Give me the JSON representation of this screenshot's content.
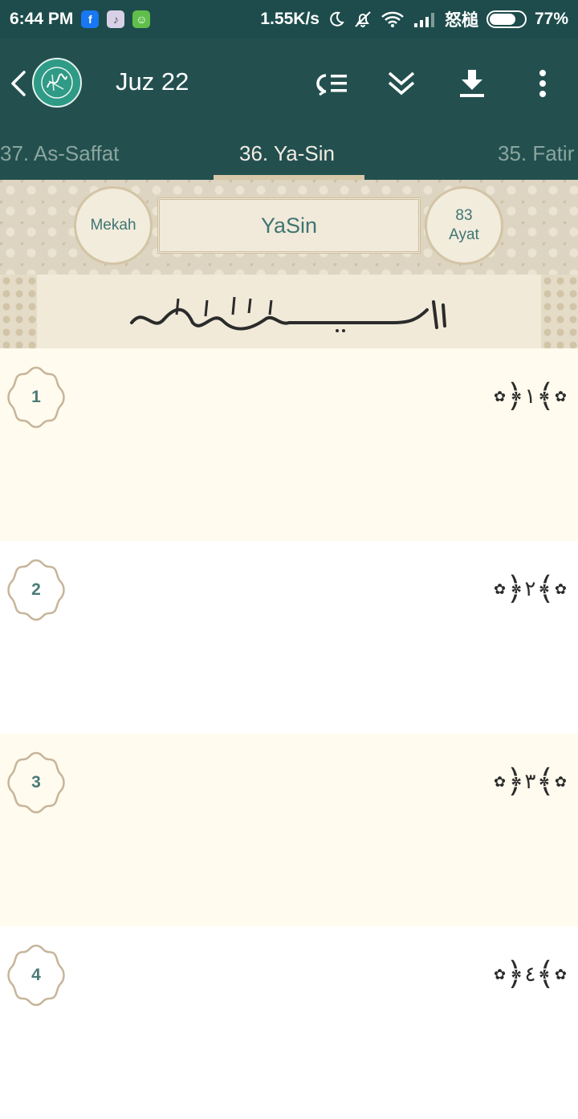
{
  "status_bar": {
    "time": "6:44 PM",
    "network_speed": "1.55K/s",
    "carrier": "怒槌",
    "battery_percent": "77%",
    "battery_level": 0.77,
    "app_icons": [
      "facebook-icon",
      "tiktok-icon",
      "android-icon"
    ]
  },
  "toolbar": {
    "title": "Juz 22",
    "actions": [
      "goto-verse-icon",
      "scroll-down-icon",
      "download-icon",
      "more-vert-icon"
    ]
  },
  "tabs": {
    "left": "37. As-Saffat",
    "selected": "36. Ya-Sin",
    "right": "35. Fatir"
  },
  "surah_header": {
    "revelation_place": "Mekah",
    "surah_name": "YaSin",
    "ayat_count": "83",
    "ayat_label": "Ayat",
    "bismillah": "بسم الله الرحمن الرحيم"
  },
  "ayahs": [
    {
      "number": "1",
      "marker": "١"
    },
    {
      "number": "2",
      "marker": "٢"
    },
    {
      "number": "3",
      "marker": "٣"
    },
    {
      "number": "4",
      "marker": "٤"
    }
  ],
  "colors": {
    "status_bar": "#1e4c4c",
    "toolbar": "#23504f",
    "accent_teal": "#3f7572",
    "header_beige": "#efe8d8",
    "row_cream": "#fffbee"
  }
}
